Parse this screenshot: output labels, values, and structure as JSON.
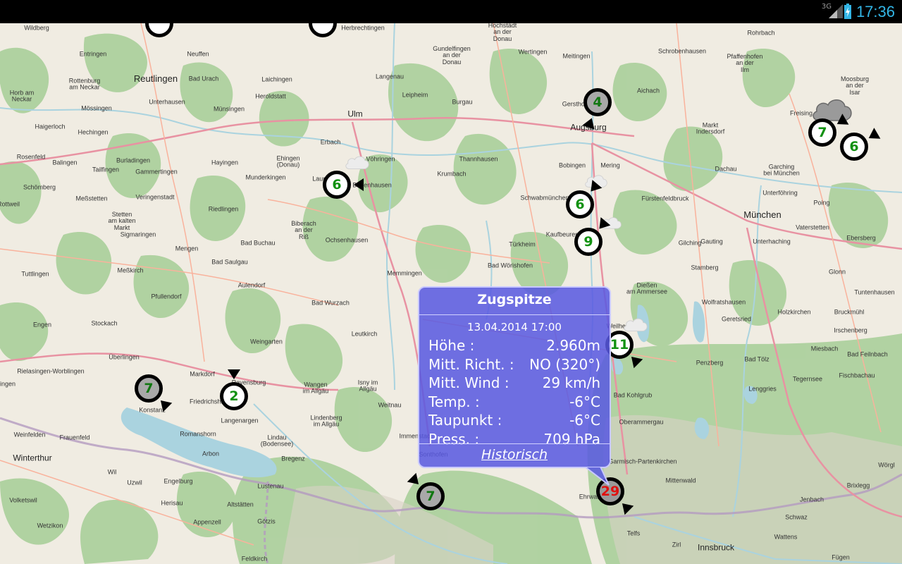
{
  "status_bar": {
    "network": "3G",
    "time": "17:36"
  },
  "colors": {
    "popup_bg": "#5858e1",
    "marker_value_green": "#119111",
    "marker_value_red": "#e01010",
    "statusbar_time": "#33b5e5"
  },
  "map": {
    "places": [
      {
        "name": "Wildberg",
        "size": "small"
      },
      {
        "name": "Herbrechtingen",
        "size": "small"
      },
      {
        "name": "Hochstädt\nan der\nDonau",
        "size": "small"
      },
      {
        "name": "Rohrbach",
        "size": "small"
      },
      {
        "name": "Pfaffenhofen\nan der\nIlm",
        "size": "small"
      },
      {
        "name": "Entringen",
        "size": "small"
      },
      {
        "name": "Neuffen",
        "size": "small"
      },
      {
        "name": "Gundelfingen\nan der\nDonau",
        "size": "small"
      },
      {
        "name": "Wertingen",
        "size": "small"
      },
      {
        "name": "Meitingen",
        "size": "small"
      },
      {
        "name": "Schrobenhausen",
        "size": "small"
      },
      {
        "name": "Reutlingen",
        "size": "big"
      },
      {
        "name": "Bad Urach",
        "size": "small"
      },
      {
        "name": "Laichingen",
        "size": "small"
      },
      {
        "name": "Langenau",
        "size": "small"
      },
      {
        "name": "Rottenburg\nam Neckar",
        "size": "small"
      },
      {
        "name": "Horb am\nNeckar",
        "size": "small"
      },
      {
        "name": "Heroldstatt",
        "size": "small"
      },
      {
        "name": "Leipheim",
        "size": "small"
      },
      {
        "name": "Aichach",
        "size": "small"
      },
      {
        "name": "Moosburg\nan der\nIsar",
        "size": "small"
      },
      {
        "name": "Unterhausen",
        "size": "small"
      },
      {
        "name": "Mössingen",
        "size": "small"
      },
      {
        "name": "Münsingen",
        "size": "small"
      },
      {
        "name": "Ulm",
        "size": "med"
      },
      {
        "name": "Burgau",
        "size": "small"
      },
      {
        "name": "Gersthofen",
        "size": "small"
      },
      {
        "name": "Haigerloch",
        "size": "small"
      },
      {
        "name": "Hechingen",
        "size": "small"
      },
      {
        "name": "Augsburg",
        "size": "med"
      },
      {
        "name": "Markt\nIndersdorf",
        "size": "small"
      },
      {
        "name": "Freising",
        "size": "small"
      },
      {
        "name": "Rosenfeld",
        "size": "small"
      },
      {
        "name": "Balingen",
        "size": "small"
      },
      {
        "name": "Burladingen",
        "size": "small"
      },
      {
        "name": "Ehingen\n(Donau)",
        "size": "small"
      },
      {
        "name": "Erbach",
        "size": "small"
      },
      {
        "name": "Vöhringen",
        "size": "small"
      },
      {
        "name": "Thannhausen",
        "size": "small"
      },
      {
        "name": "Tailfingen",
        "size": "small"
      },
      {
        "name": "Gammertingen",
        "size": "small"
      },
      {
        "name": "Hayingen",
        "size": "small"
      },
      {
        "name": "Bobingen",
        "size": "small"
      },
      {
        "name": "Mering",
        "size": "small"
      },
      {
        "name": "Dachau",
        "size": "small"
      },
      {
        "name": "Garching\nbei München",
        "size": "small"
      },
      {
        "name": "Munderkingen",
        "size": "small"
      },
      {
        "name": "Krumbach",
        "size": "small"
      },
      {
        "name": "Schömberg",
        "size": "small"
      },
      {
        "name": "Veringenstadt",
        "size": "small"
      },
      {
        "name": "Laupheim",
        "size": "small"
      },
      {
        "name": "Babenhausen",
        "size": "small"
      },
      {
        "name": "Schwabmünchen",
        "size": "small"
      },
      {
        "name": "Unterföhring",
        "size": "small"
      },
      {
        "name": "Meßstetten",
        "size": "small"
      },
      {
        "name": "Fürstenfeldbruck",
        "size": "small"
      },
      {
        "name": "Poing",
        "size": "small"
      },
      {
        "name": "Rottweil",
        "size": "small"
      },
      {
        "name": "Riedlingen",
        "size": "small"
      },
      {
        "name": "Stetten\nam kalten\nMarkt",
        "size": "small"
      },
      {
        "name": "München",
        "size": "big"
      },
      {
        "name": "Biberach\nan der\nRiß",
        "size": "small"
      },
      {
        "name": "Ochsenhausen",
        "size": "small"
      },
      {
        "name": "Kaufbeuren",
        "size": "small"
      },
      {
        "name": "Gilching",
        "size": "small"
      },
      {
        "name": "Vaterstetten",
        "size": "small"
      },
      {
        "name": "Sigmaringen",
        "size": "small"
      },
      {
        "name": "Bad Buchau",
        "size": "small"
      },
      {
        "name": "Türkheim",
        "size": "small"
      },
      {
        "name": "Gauting",
        "size": "small"
      },
      {
        "name": "Unterhaching",
        "size": "small"
      },
      {
        "name": "Ebersberg",
        "size": "small"
      },
      {
        "name": "Mengen",
        "size": "small"
      },
      {
        "name": "Bad Saulgau",
        "size": "small"
      },
      {
        "name": "Bad Wörishofen",
        "size": "small"
      },
      {
        "name": "Meßkirch",
        "size": "small"
      },
      {
        "name": "Memmingen",
        "size": "small"
      },
      {
        "name": "Stamberg",
        "size": "small"
      },
      {
        "name": "Tuttlingen",
        "size": "small"
      },
      {
        "name": "Glonn",
        "size": "small"
      },
      {
        "name": "Aulendorf",
        "size": "small"
      },
      {
        "name": "Dießen\nam Ammersee",
        "size": "small"
      },
      {
        "name": "Pfullendorf",
        "size": "small"
      },
      {
        "name": "Tuntenhausen",
        "size": "small"
      },
      {
        "name": "Bad Wurzach",
        "size": "small"
      },
      {
        "name": "Wolfratshausen",
        "size": "small"
      },
      {
        "name": "Holzkirchen",
        "size": "small"
      },
      {
        "name": "Bruckmühl",
        "size": "small"
      },
      {
        "name": "Stockach",
        "size": "small"
      },
      {
        "name": "Engen",
        "size": "small"
      },
      {
        "name": "Leutkirch",
        "size": "small"
      },
      {
        "name": "Weilheim",
        "size": "small"
      },
      {
        "name": "Geretsried",
        "size": "small"
      },
      {
        "name": "Irschenberg",
        "size": "small"
      },
      {
        "name": "Weingarten",
        "size": "small"
      },
      {
        "name": "Miesbach",
        "size": "small"
      },
      {
        "name": "Bad Feilnbach",
        "size": "small"
      },
      {
        "name": "Überlingen",
        "size": "small"
      },
      {
        "name": "Penzberg",
        "size": "small"
      },
      {
        "name": "Bad Tölz",
        "size": "small"
      },
      {
        "name": "Rielasingen-Worblingen",
        "size": "small"
      },
      {
        "name": "Markdorf",
        "size": "small"
      },
      {
        "name": "Ravensburg",
        "size": "small"
      },
      {
        "name": "Isny im\nAllgäu",
        "size": "small"
      },
      {
        "name": "Fischbachau",
        "size": "small"
      },
      {
        "name": "Singen",
        "size": "small"
      },
      {
        "name": "Wangen\nim Allgäu",
        "size": "small"
      },
      {
        "name": "Bad Kohlgrub",
        "size": "small"
      },
      {
        "name": "Tegernsee",
        "size": "small"
      },
      {
        "name": "Lenggries",
        "size": "small"
      },
      {
        "name": "Friedrichshafen",
        "size": "small"
      },
      {
        "name": "Langenargen",
        "size": "small"
      },
      {
        "name": "Weitnau",
        "size": "small"
      },
      {
        "name": "Konstanz",
        "size": "small"
      },
      {
        "name": "Lindenberg\nim Allgäu",
        "size": "small"
      },
      {
        "name": "Weinfelden",
        "size": "small"
      },
      {
        "name": "Frauenfeld",
        "size": "small"
      },
      {
        "name": "Romanshorn",
        "size": "small"
      },
      {
        "name": "Oberammergau",
        "size": "small"
      },
      {
        "name": "Lindau\n(Bodensee)",
        "size": "small"
      },
      {
        "name": "Immenstadt",
        "size": "small"
      },
      {
        "name": "Arbon",
        "size": "small"
      },
      {
        "name": "Bregenz",
        "size": "small"
      },
      {
        "name": "Sonthofen",
        "size": "small"
      },
      {
        "name": "Garmisch-Partenkirchen",
        "size": "small"
      },
      {
        "name": "Winterthur",
        "size": "med"
      },
      {
        "name": "Wil",
        "size": "small"
      },
      {
        "name": "Mittenwald",
        "size": "small"
      },
      {
        "name": "Wörgl",
        "size": "small"
      },
      {
        "name": "Uzwil",
        "size": "small"
      },
      {
        "name": "Engelburg",
        "size": "small"
      },
      {
        "name": "Lustenau",
        "size": "small"
      },
      {
        "name": "Ehrwald",
        "size": "small"
      },
      {
        "name": "Brixlegg",
        "size": "small"
      },
      {
        "name": "Volketswil",
        "size": "small"
      },
      {
        "name": "Herisau",
        "size": "small"
      },
      {
        "name": "Altstätten",
        "size": "small"
      },
      {
        "name": "Jenbach",
        "size": "small"
      },
      {
        "name": "Appenzell",
        "size": "small"
      },
      {
        "name": "Schwaz",
        "size": "small"
      },
      {
        "name": "Wetzikon",
        "size": "small"
      },
      {
        "name": "Götzis",
        "size": "small"
      },
      {
        "name": "Telfs",
        "size": "small"
      },
      {
        "name": "Wattens",
        "size": "small"
      },
      {
        "name": "Zirl",
        "size": "small"
      },
      {
        "name": "Innsbruck",
        "size": "med"
      },
      {
        "name": "Feldkirch",
        "size": "small"
      },
      {
        "name": "Fügen",
        "size": "small"
      }
    ],
    "stations": [
      {
        "name": "station-top-left",
        "value": "",
        "style": "light",
        "arrow_deg": 0
      },
      {
        "name": "station-top-mid",
        "value": "",
        "style": "light",
        "arrow_deg": 0
      },
      {
        "name": "station-augsburg",
        "value": "4",
        "style": "gray",
        "arrow_deg": 200
      },
      {
        "name": "station-freising-a",
        "value": "7",
        "style": "light",
        "arrow_deg": 60
      },
      {
        "name": "station-freising-b",
        "value": "6",
        "style": "light",
        "arrow_deg": 60
      },
      {
        "name": "station-laupheim",
        "value": "6",
        "style": "light",
        "arrow_deg": 90
      },
      {
        "name": "station-schwabmuenchen",
        "value": "6",
        "style": "light",
        "arrow_deg": 40
      },
      {
        "name": "station-kaufbeuren",
        "value": "9",
        "style": "light",
        "arrow_deg": 40
      },
      {
        "name": "station-weilheim",
        "value": "11",
        "style": "light",
        "arrow_deg": 135
      },
      {
        "name": "station-konstanz",
        "value": "7",
        "style": "gray",
        "arrow_deg": 135
      },
      {
        "name": "station-friedrichshafen",
        "value": "2",
        "style": "light",
        "arrow_deg": 0
      },
      {
        "name": "station-sonthofen",
        "value": "7",
        "style": "gray",
        "arrow_deg": 315
      },
      {
        "name": "station-zugspitze",
        "value": "29",
        "style": "red",
        "arrow_deg": 135
      }
    ]
  },
  "popup": {
    "title": "Zugspitze",
    "date": "13.04.2014 17:00",
    "rows": [
      {
        "label": "Höhe :",
        "value": "2.960m"
      },
      {
        "label": "Mitt. Richt. :",
        "value": "NO (320°)"
      },
      {
        "label": "Mitt. Wind :",
        "value": "29 km/h"
      },
      {
        "label": "Temp. :",
        "value": "-6°C"
      },
      {
        "label": "Taupunkt :",
        "value": "-6°C"
      },
      {
        "label": "Press. :",
        "value": "709 hPa"
      }
    ],
    "history_link": "Historisch"
  }
}
